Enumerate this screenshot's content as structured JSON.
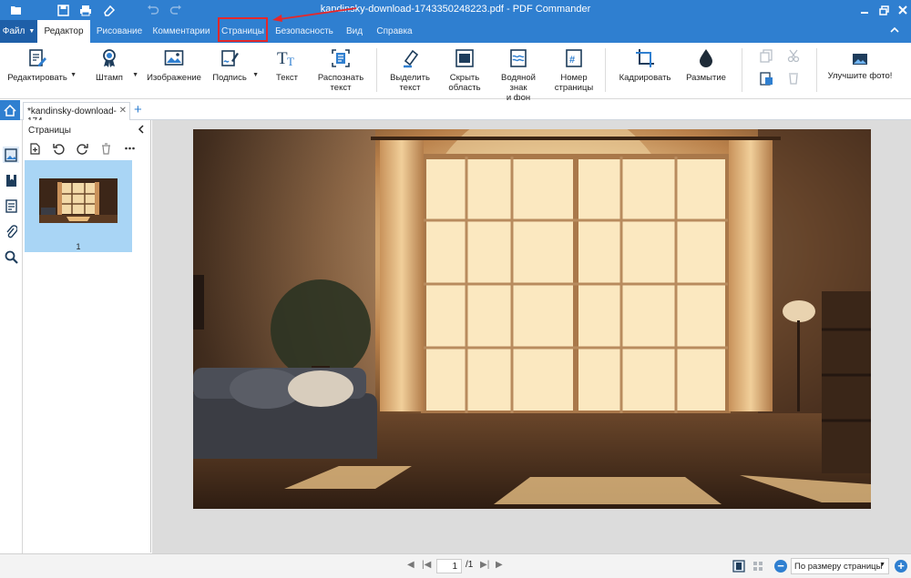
{
  "window": {
    "title": "kandinsky-download-1743350248223.pdf - PDF Commander"
  },
  "menu": {
    "file_label": "Файл",
    "tabs": [
      "Редактор",
      "Рисование",
      "Комментарии",
      "Страницы",
      "Безопасность",
      "Вид",
      "Справка"
    ],
    "active_tab": "Редактор",
    "highlighted_tab": "Страницы"
  },
  "ribbon": {
    "edit": "Редактировать",
    "stamp": "Штамп",
    "image": "Изображение",
    "signature": "Подпись",
    "text": "Текст",
    "recognize_l1": "Распознать",
    "recognize_l2": "текст",
    "highlight_l1": "Выделить",
    "highlight_l2": "текст",
    "hide_l1": "Скрыть",
    "hide_l2": "область",
    "watermark_l1": "Водяной знак",
    "watermark_l2": "и фон",
    "pagenum_l1": "Номер",
    "pagenum_l2": "страницы",
    "crop": "Кадрировать",
    "blur": "Размытие",
    "improve": "Улучшите фото!"
  },
  "document_tab": {
    "label": "*kandinsky-download-174...",
    "close": "✕",
    "add": "+"
  },
  "pages_panel": {
    "header": "Страницы",
    "thumb_page_number": "1"
  },
  "status": {
    "current_page": "1",
    "total_pages": "/1",
    "zoom_mode": "По размеру страницы"
  },
  "colors": {
    "accent": "#2f7fd0",
    "highlight_border": "#e5282a",
    "thumb_selected": "#a9d5f5"
  }
}
